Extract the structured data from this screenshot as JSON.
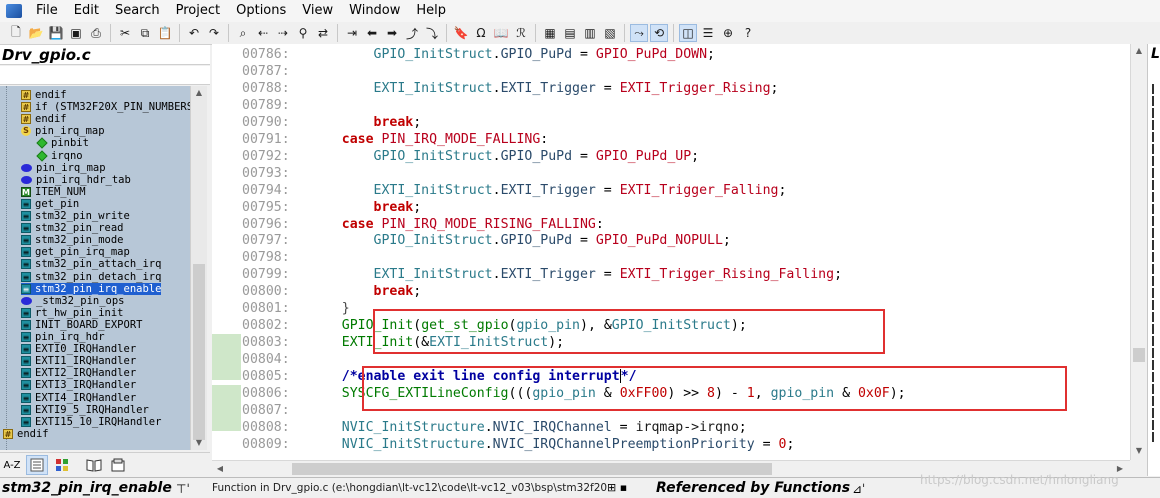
{
  "menu": [
    "File",
    "Edit",
    "Search",
    "Project",
    "Options",
    "View",
    "Window",
    "Help"
  ],
  "toolbar_icons": [
    "new-file-icon",
    "open-icon",
    "save-icon",
    "save-all-icon",
    "print-icon",
    "cut-icon",
    "copy-icon",
    "paste-icon",
    "undo-icon",
    "redo-icon",
    "find-icon",
    "find-prev-icon",
    "find-next-icon",
    "find-files-icon",
    "replace-icon",
    "goto-line-icon",
    "back-icon",
    "forward-icon",
    "jump-icon",
    "jump-back-icon",
    "bookmark-icon",
    "symbol-icon",
    "browse-icon",
    "reference-icon",
    "window-icon",
    "tile-icon",
    "split-icon",
    "layout-icon",
    "relation-icon",
    "sync-icon",
    "project-icon",
    "outline-icon",
    "lookup-icon",
    "help-icon"
  ],
  "left_panel": {
    "title": "Drv_gpio.c",
    "tree": [
      {
        "icon": "hash",
        "label": "endif",
        "indent": 2
      },
      {
        "icon": "hash",
        "label": "if (STM32F20X_PIN_NUMBERS",
        "indent": 2
      },
      {
        "icon": "hash",
        "label": "endif",
        "indent": 2
      },
      {
        "icon": "s",
        "label": "pin_irq_map",
        "indent": 2
      },
      {
        "icon": "diamond",
        "label": "pinbit",
        "indent": 3
      },
      {
        "icon": "diamond",
        "label": "irqno",
        "indent": 3
      },
      {
        "icon": "ellipse",
        "label": "pin_irq_map",
        "indent": 2
      },
      {
        "icon": "ellipse",
        "label": "pin_irq_hdr_tab",
        "indent": 2
      },
      {
        "icon": "mbox",
        "label": "ITEM_NUM",
        "indent": 2
      },
      {
        "icon": "func",
        "label": "get_pin",
        "indent": 2
      },
      {
        "icon": "func",
        "label": "stm32_pin_write",
        "indent": 2
      },
      {
        "icon": "func",
        "label": "stm32_pin_read",
        "indent": 2
      },
      {
        "icon": "func",
        "label": "stm32_pin_mode",
        "indent": 2
      },
      {
        "icon": "func",
        "label": "get_pin_irq_map",
        "indent": 2
      },
      {
        "icon": "func",
        "label": "stm32_pin_attach_irq",
        "indent": 2
      },
      {
        "icon": "func",
        "label": "stm32_pin_detach_irq",
        "indent": 2
      },
      {
        "icon": "func",
        "label": "stm32_pin_irq_enable",
        "indent": 2,
        "selected": true
      },
      {
        "icon": "ellipse",
        "label": "_stm32_pin_ops",
        "indent": 2
      },
      {
        "icon": "func",
        "label": "rt_hw_pin_init",
        "indent": 2
      },
      {
        "icon": "func",
        "label": "INIT_BOARD_EXPORT",
        "indent": 2
      },
      {
        "icon": "func",
        "label": "pin_irq_hdr",
        "indent": 2
      },
      {
        "icon": "func",
        "label": "EXTI0_IRQHandler",
        "indent": 2
      },
      {
        "icon": "func",
        "label": "EXTI1_IRQHandler",
        "indent": 2
      },
      {
        "icon": "func",
        "label": "EXTI2_IRQHandler",
        "indent": 2
      },
      {
        "icon": "func",
        "label": "EXTI3_IRQHandler",
        "indent": 2
      },
      {
        "icon": "func",
        "label": "EXTI4_IRQHandler",
        "indent": 2
      },
      {
        "icon": "func",
        "label": "EXTI9_5_IRQHandler",
        "indent": 2
      },
      {
        "icon": "func",
        "label": "EXTI15_10_IRQHandler",
        "indent": 2
      },
      {
        "icon": "hash",
        "label": "endif",
        "indent": 0
      }
    ],
    "bottom_buttons": [
      "A-Z",
      "symbol-list-icon",
      "category-icon",
      "book-icon",
      "context-icon"
    ]
  },
  "editor": {
    "lines": [
      {
        "no": "00786:",
        "tokens": [
          [
            "sp",
            "        "
          ],
          [
            "ty",
            "GPIO_InitStruct"
          ],
          [
            "op",
            "."
          ],
          [
            "fld",
            "GPIO_PuPd"
          ],
          [
            "op",
            " = "
          ],
          [
            "mac",
            "GPIO_PuPd_DOWN"
          ],
          [
            "op",
            ";"
          ]
        ]
      },
      {
        "no": "00787:",
        "tokens": []
      },
      {
        "no": "00788:",
        "tokens": [
          [
            "sp",
            "        "
          ],
          [
            "ty",
            "EXTI_InitStruct"
          ],
          [
            "op",
            "."
          ],
          [
            "fld",
            "EXTI_Trigger"
          ],
          [
            "op",
            " = "
          ],
          [
            "mac",
            "EXTI_Trigger_Rising"
          ],
          [
            "op",
            ";"
          ]
        ]
      },
      {
        "no": "00789:",
        "tokens": []
      },
      {
        "no": "00790:",
        "tokens": [
          [
            "sp",
            "        "
          ],
          [
            "kw",
            "break"
          ],
          [
            "op",
            ";"
          ]
        ]
      },
      {
        "no": "00791:",
        "tokens": [
          [
            "sp",
            "    "
          ],
          [
            "kw",
            "case"
          ],
          [
            "op",
            " "
          ],
          [
            "mac",
            "PIN_IRQ_MODE_FALLING"
          ],
          [
            "op",
            ":"
          ]
        ]
      },
      {
        "no": "00792:",
        "tokens": [
          [
            "sp",
            "        "
          ],
          [
            "ty",
            "GPIO_InitStruct"
          ],
          [
            "op",
            "."
          ],
          [
            "fld",
            "GPIO_PuPd"
          ],
          [
            "op",
            " = "
          ],
          [
            "mac",
            "GPIO_PuPd_UP"
          ],
          [
            "op",
            ";"
          ]
        ]
      },
      {
        "no": "00793:",
        "tokens": []
      },
      {
        "no": "00794:",
        "tokens": [
          [
            "sp",
            "        "
          ],
          [
            "ty",
            "EXTI_InitStruct"
          ],
          [
            "op",
            "."
          ],
          [
            "fld",
            "EXTI_Trigger"
          ],
          [
            "op",
            " = "
          ],
          [
            "mac",
            "EXTI_Trigger_Falling"
          ],
          [
            "op",
            ";"
          ]
        ]
      },
      {
        "no": "00795:",
        "tokens": [
          [
            "sp",
            "        "
          ],
          [
            "kw",
            "break"
          ],
          [
            "op",
            ";"
          ]
        ]
      },
      {
        "no": "00796:",
        "tokens": [
          [
            "sp",
            "    "
          ],
          [
            "kw",
            "case"
          ],
          [
            "op",
            " "
          ],
          [
            "mac",
            "PIN_IRQ_MODE_RISING_FALLING"
          ],
          [
            "op",
            ":"
          ]
        ]
      },
      {
        "no": "00797:",
        "tokens": [
          [
            "sp",
            "        "
          ],
          [
            "ty",
            "GPIO_InitStruct"
          ],
          [
            "op",
            "."
          ],
          [
            "fld",
            "GPIO_PuPd"
          ],
          [
            "op",
            " = "
          ],
          [
            "mac",
            "GPIO_PuPd_NOPULL"
          ],
          [
            "op",
            ";"
          ]
        ]
      },
      {
        "no": "00798:",
        "tokens": []
      },
      {
        "no": "00799:",
        "tokens": [
          [
            "sp",
            "        "
          ],
          [
            "ty",
            "EXTI_InitStruct"
          ],
          [
            "op",
            "."
          ],
          [
            "fld",
            "EXTI_Trigger"
          ],
          [
            "op",
            " = "
          ],
          [
            "mac",
            "EXTI_Trigger_Rising_Falling"
          ],
          [
            "op",
            ";"
          ]
        ]
      },
      {
        "no": "00800:",
        "tokens": [
          [
            "sp",
            "        "
          ],
          [
            "kw",
            "break"
          ],
          [
            "op",
            ";"
          ]
        ]
      },
      {
        "no": "00801:",
        "tokens": [
          [
            "sp",
            "    "
          ],
          [
            "br",
            "}"
          ]
        ]
      },
      {
        "no": "00802:",
        "tokens": [
          [
            "sp",
            "    "
          ],
          [
            "fn",
            "GPIO_Init"
          ],
          [
            "op",
            "("
          ],
          [
            "fn",
            "get_st_gpio"
          ],
          [
            "op",
            "("
          ],
          [
            "ty",
            "gpio_pin"
          ],
          [
            "op",
            "), &"
          ],
          [
            "ty",
            "GPIO_InitStruct"
          ],
          [
            "op",
            ");"
          ]
        ]
      },
      {
        "no": "00803:",
        "tokens": [
          [
            "sp",
            "    "
          ],
          [
            "fn",
            "EXTI_Init"
          ],
          [
            "op",
            "(&"
          ],
          [
            "ty",
            "EXTI_InitStruct"
          ],
          [
            "op",
            ");"
          ]
        ]
      },
      {
        "no": "00804:",
        "tokens": []
      },
      {
        "no": "00805:",
        "tokens": [
          [
            "sp",
            "    "
          ],
          [
            "cmb",
            "/*enable exit line config interrupt"
          ],
          [
            "caret",
            ""
          ],
          [
            "cmb",
            "*/"
          ]
        ]
      },
      {
        "no": "00806:",
        "tokens": [
          [
            "sp",
            "    "
          ],
          [
            "fn",
            "SYSCFG_EXTILineConfig"
          ],
          [
            "op",
            "((("
          ],
          [
            "ty",
            "gpio_pin"
          ],
          [
            "op",
            " & "
          ],
          [
            "num",
            "0xFF00"
          ],
          [
            "op",
            ") >> "
          ],
          [
            "num",
            "8"
          ],
          [
            "op",
            ") - "
          ],
          [
            "num",
            "1"
          ],
          [
            "op",
            ", "
          ],
          [
            "ty",
            "gpio_pin"
          ],
          [
            "op",
            " & "
          ],
          [
            "num",
            "0x0F"
          ],
          [
            "op",
            ");"
          ]
        ]
      },
      {
        "no": "00807:",
        "tokens": []
      },
      {
        "no": "00808:",
        "tokens": [
          [
            "sp",
            "    "
          ],
          [
            "ty",
            "NVIC_InitStructure"
          ],
          [
            "op",
            "."
          ],
          [
            "fld",
            "NVIC_IRQChannel"
          ],
          [
            "op",
            " = "
          ],
          [
            "dk",
            "irqmap->irqno"
          ],
          [
            "op",
            ";"
          ]
        ]
      },
      {
        "no": "00809:",
        "tokens": [
          [
            "sp",
            "    "
          ],
          [
            "ty",
            "NVIC_InitStructure"
          ],
          [
            "op",
            "."
          ],
          [
            "fld",
            "NVIC_IRQChannelPreemptionPriority"
          ],
          [
            "op",
            " = "
          ],
          [
            "num",
            "0"
          ],
          [
            "op",
            ";"
          ]
        ]
      }
    ]
  },
  "status": {
    "left_title": "stm32_pin_irq_enable",
    "mid": "Function in Drv_gpio.c (e:\\hongdian\\lt-vc12\\code\\lt-vc12_v03\\bsp\\stm32f20",
    "right_title": "Referenced by Functions",
    "right_panel_title": "Lin",
    "watermark": "https://blog.csdn.net/hnlongliang"
  }
}
